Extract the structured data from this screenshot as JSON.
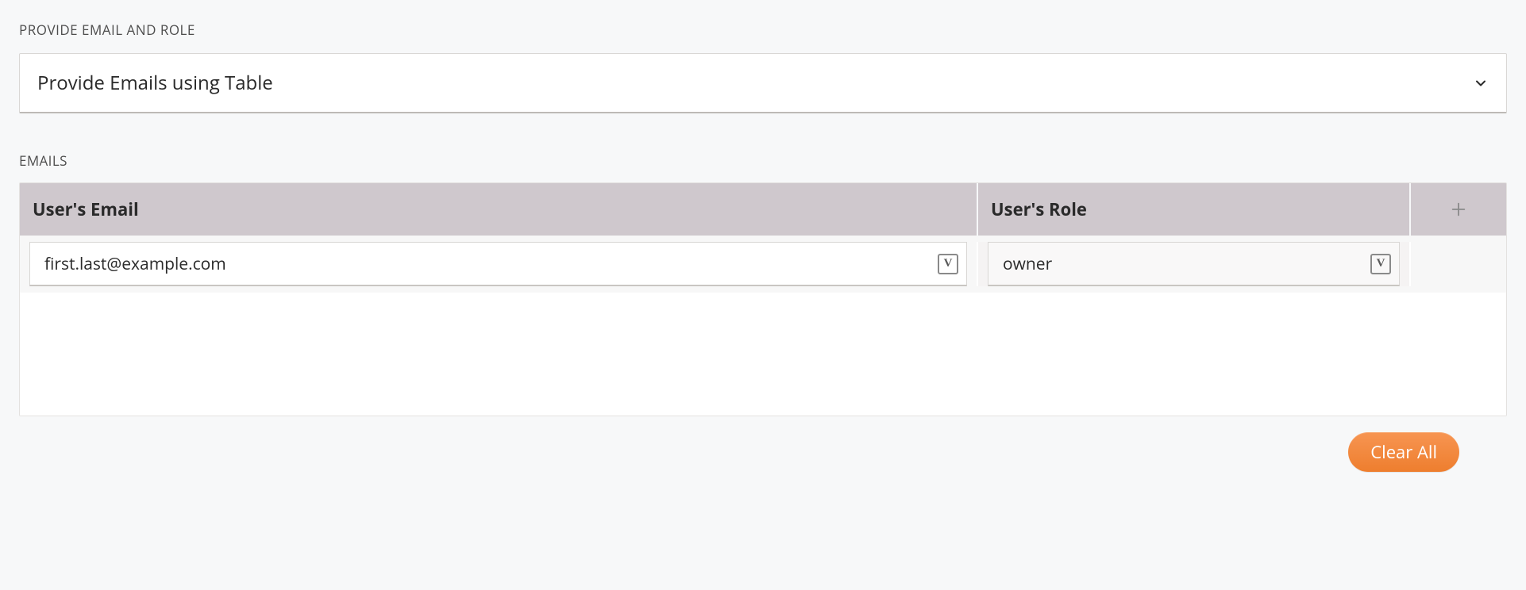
{
  "section": {
    "label": "PROVIDE EMAIL AND ROLE",
    "dropdown_value": "Provide Emails using Table"
  },
  "emails_section": {
    "label": "EMAILS",
    "headers": {
      "email": "User's Email",
      "role": "User's Role"
    },
    "rows": [
      {
        "email": "first.last@example.com",
        "role": "owner"
      }
    ]
  },
  "footer": {
    "clear_all": "Clear All"
  },
  "icons": {
    "variable_badge": "V"
  }
}
